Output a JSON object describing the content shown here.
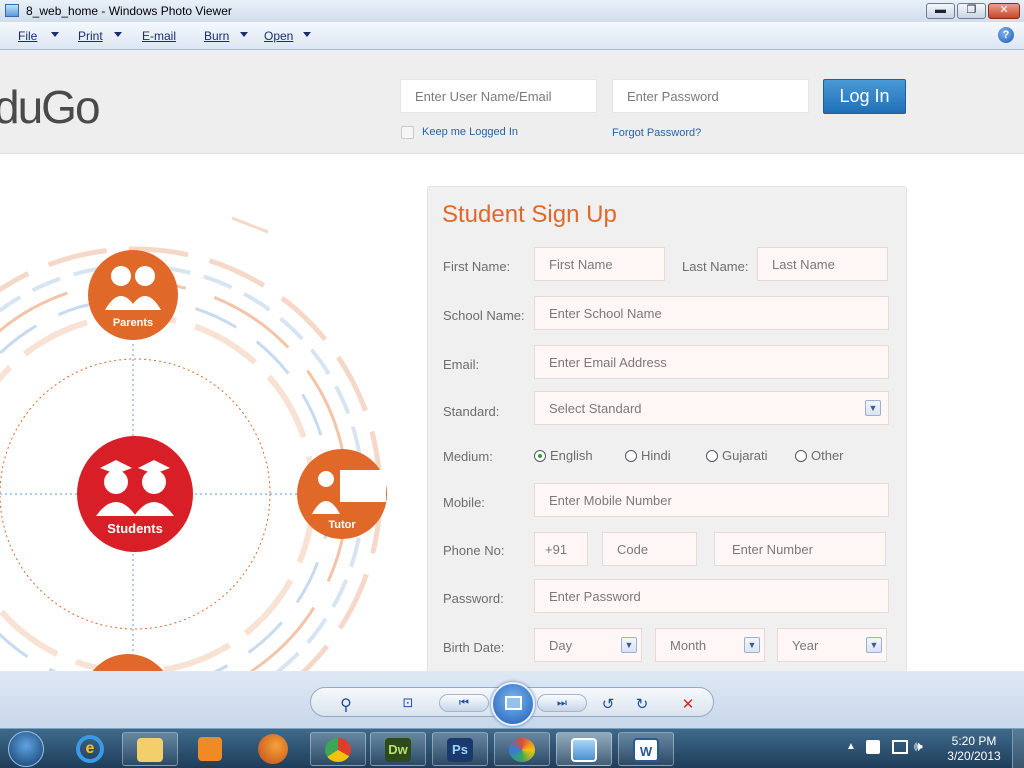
{
  "window": {
    "title": "8_web_home - Windows Photo Viewer",
    "minimize_label": "▬",
    "maximize_label": "❐",
    "close_label": "✕"
  },
  "menu": {
    "items": [
      {
        "label": "File"
      },
      {
        "label": "Print"
      },
      {
        "label": "E-mail"
      },
      {
        "label": "Burn"
      },
      {
        "label": "Open"
      }
    ],
    "help_label": "?"
  },
  "site": {
    "logo_text": "duGo",
    "login": {
      "username_placeholder": "Enter User Name/Email",
      "password_placeholder": "Enter Password",
      "login_button": "Log In",
      "keep_logged_in": "Keep me Logged In",
      "forgot_password": "Forgot Password?"
    },
    "diagram": {
      "parents_label": "Parents",
      "students_label": "Students",
      "tutor_label": "Tutor"
    },
    "signup": {
      "title": "Student Sign Up",
      "first_name_label": "First Name:",
      "first_name_placeholder": "First Name",
      "last_name_label": "Last Name:",
      "last_name_placeholder": "Last Name",
      "school_label": "School Name:",
      "school_placeholder": "Enter School Name",
      "email_label": "Email:",
      "email_placeholder": "Enter Email Address",
      "standard_label": "Standard:",
      "standard_value": "Select Standard",
      "medium_label": "Medium:",
      "medium_options": [
        "English",
        "Hindi",
        "Gujarati",
        "Other"
      ],
      "medium_selected": "English",
      "mobile_label": "Mobile:",
      "mobile_placeholder": "Enter Mobile Number",
      "phone_label": "Phone No:",
      "phone_prefix": "+91",
      "phone_code_placeholder": "Code",
      "phone_number_placeholder": "Enter Number",
      "password_label": "Password:",
      "password_placeholder": "Enter Password",
      "birth_label": "Birth Date:",
      "day_value": "Day",
      "month_value": "Month",
      "year_value": "Year"
    }
  },
  "taskbar": {
    "time": "5:20 PM",
    "date": "3/20/2013",
    "apps": [
      {
        "name": "ie-icon"
      },
      {
        "name": "explorer-icon"
      },
      {
        "name": "media-icon"
      },
      {
        "name": "firefox-icon"
      },
      {
        "name": "chrome-icon"
      },
      {
        "name": "dreamweaver-icon",
        "label": "Dw"
      },
      {
        "name": "photoshop-icon",
        "label": "Ps"
      },
      {
        "name": "paint-icon"
      },
      {
        "name": "photo-viewer-icon"
      },
      {
        "name": "word-icon",
        "label": "W"
      }
    ]
  },
  "colors": {
    "orange": "#e0692a",
    "red": "#d81e26",
    "link_blue": "#2364a8"
  }
}
